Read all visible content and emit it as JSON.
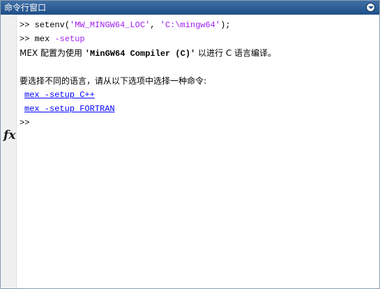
{
  "window": {
    "title": "命令行窗口"
  },
  "console": {
    "line1": {
      "prompt": ">>",
      "cmd": "setenv(",
      "arg1": "'MW_MINGW64_LOC'",
      "sep": ", ",
      "arg2": "'C:\\mingw64'",
      "end": ");"
    },
    "line2": {
      "prompt": ">>",
      "cmd": "mex ",
      "opt": "-setup"
    },
    "line3": {
      "pre": "MEX 配置为使用 ",
      "compiler": "'MinGW64 Compiler (C)'",
      "post": " 以进行 C 语言编译。"
    },
    "line4": {
      "text": "要选择不同的语言，请从以下选项中选择一种命令:"
    },
    "links": [
      "mex -setup C++",
      "mex -setup FORTRAN"
    ],
    "prompt_last": ">>",
    "gutter_symbol": "fx"
  }
}
